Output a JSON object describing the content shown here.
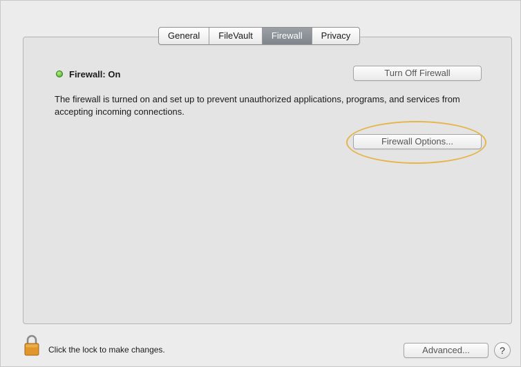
{
  "tabs": [
    {
      "label": "General",
      "selected": false
    },
    {
      "label": "FileVault",
      "selected": false
    },
    {
      "label": "Firewall",
      "selected": true
    },
    {
      "label": "Privacy",
      "selected": false
    }
  ],
  "firewall": {
    "status_label": "Firewall: On",
    "status_color": "#3fa31c",
    "turn_off_label": "Turn Off Firewall",
    "description": "The firewall is turned on and set up to prevent unauthorized applications, programs, and services from accepting incoming connections.",
    "options_label": "Firewall Options..."
  },
  "footer": {
    "lock_icon": "padlock-icon",
    "lock_label": "Click the lock to make changes.",
    "advanced_label": "Advanced...",
    "help_label": "?"
  },
  "highlight_color": "#e6b449"
}
